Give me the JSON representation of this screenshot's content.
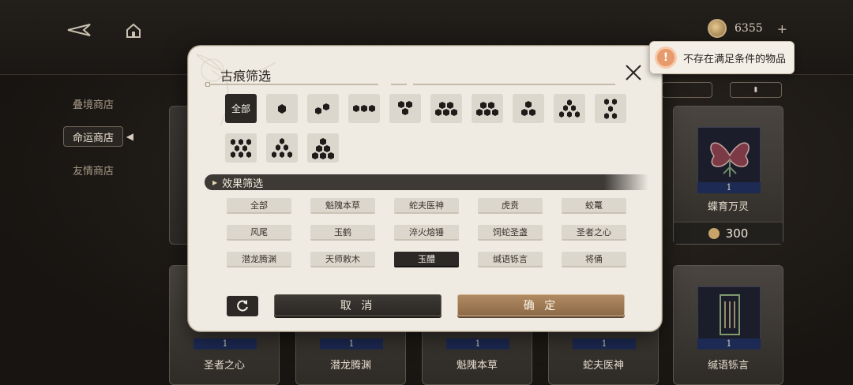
{
  "currency": {
    "value": "6355",
    "plus": "+"
  },
  "side_nav": [
    {
      "label": "叠境商店",
      "active": false
    },
    {
      "label": "命运商店",
      "active": true
    },
    {
      "label": "友情商店",
      "active": false
    }
  ],
  "shop_cards": {
    "right_top": {
      "count": "1",
      "name": "蝶育万灵",
      "price": "300"
    },
    "bottom": [
      {
        "count": "1",
        "name": "圣者之心"
      },
      {
        "count": "1",
        "name": "潜龙腾渊"
      },
      {
        "count": "1",
        "name": "魁隗本草"
      },
      {
        "count": "1",
        "name": "蛇夫医神"
      },
      {
        "count": "1",
        "name": "缄语铄言"
      }
    ]
  },
  "modal": {
    "title": "古痕筛选",
    "shape_filters": [
      {
        "name": "all",
        "label": "全部",
        "active": true
      },
      {
        "name": "shape-1",
        "label": ""
      },
      {
        "name": "shape-2",
        "label": ""
      },
      {
        "name": "shape-3-line",
        "label": ""
      },
      {
        "name": "shape-3-cluster",
        "label": ""
      },
      {
        "name": "shape-4-cluster",
        "label": ""
      },
      {
        "name": "shape-4-triangle",
        "label": ""
      },
      {
        "name": "shape-4-pyramid",
        "label": ""
      },
      {
        "name": "shape-5-cluster",
        "label": ""
      },
      {
        "name": "shape-5-hourglass",
        "label": ""
      },
      {
        "name": "shape-7-cluster",
        "label": ""
      },
      {
        "name": "shape-6-pyramid",
        "label": ""
      },
      {
        "name": "shape-6-triangle",
        "label": ""
      }
    ],
    "effect_section_title": "效果筛选",
    "effects": [
      {
        "label": "全部",
        "active": false
      },
      {
        "label": "魁隗本草",
        "active": false
      },
      {
        "label": "蛇夫医神",
        "active": false
      },
      {
        "label": "虎贲",
        "active": false
      },
      {
        "label": "蛟鼍",
        "active": false
      },
      {
        "label": "风尾",
        "active": false
      },
      {
        "label": "玉鹤",
        "active": false
      },
      {
        "label": "淬火熔锤",
        "active": false
      },
      {
        "label": "饲蛇圣盏",
        "active": false
      },
      {
        "label": "圣者之心",
        "active": false
      },
      {
        "label": "潜龙腾渊",
        "active": false
      },
      {
        "label": "天师敕木",
        "active": false
      },
      {
        "label": "玉醴",
        "active": true
      },
      {
        "label": "缄语铄言",
        "active": false
      },
      {
        "label": "将俑",
        "active": false
      }
    ],
    "cancel_label": "取 消",
    "confirm_label": "确 定"
  },
  "toast": {
    "icon": "!",
    "text": "不存在满足条件的物品"
  },
  "colors": {
    "accent": "#a8835d",
    "active_chip": "#2b2826",
    "chip": "#dcd7cd"
  }
}
